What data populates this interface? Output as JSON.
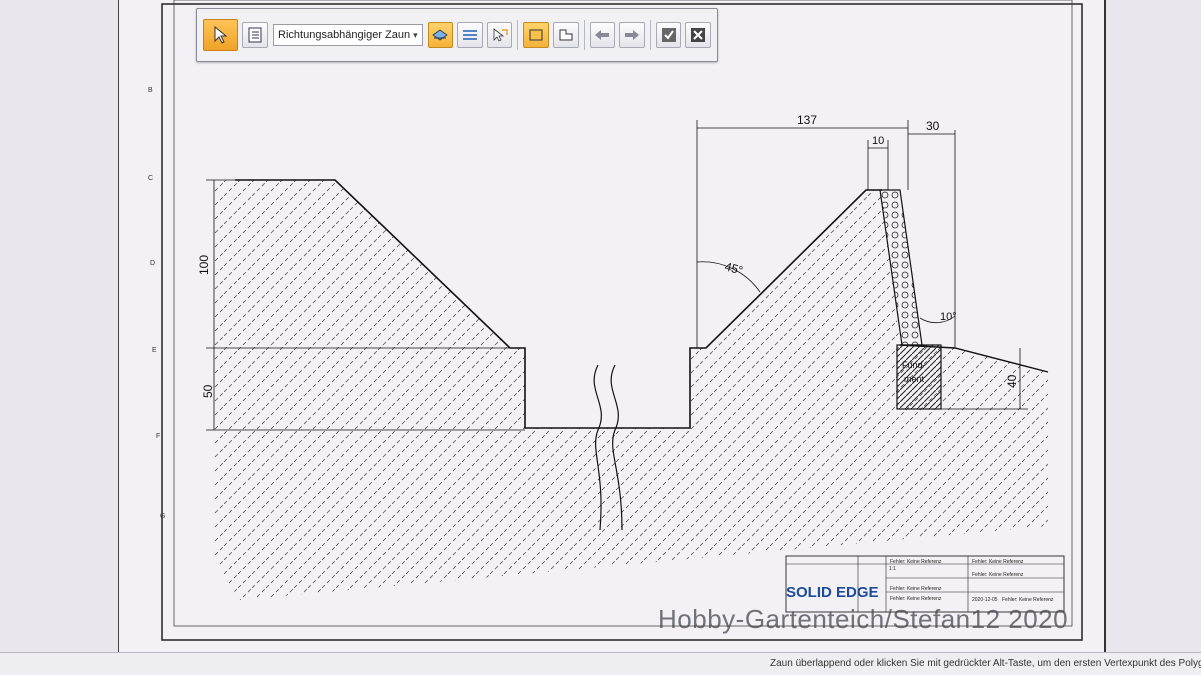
{
  "toolbar": {
    "fence_type": "Richtungsabhängiger Zaun",
    "icons": [
      "select-arrow-icon",
      "properties-icon",
      "fence-style-icon",
      "fill-icon",
      "vertex-select-icon",
      "rectangle-icon",
      "region-icon",
      "back-arrow-icon",
      "forward-arrow-icon",
      "accept-check-icon",
      "cancel-x-icon"
    ]
  },
  "dimensions": {
    "width_top": "137",
    "wall_top": "10",
    "wall_offset": "30",
    "height_slope": "100",
    "height_step": "50",
    "height_foundation": "40",
    "angle_slope": "45°",
    "angle_wall": "10°"
  },
  "labels": {
    "foundation": [
      "Fund-",
      "ment"
    ]
  },
  "title_block": {
    "logo": "SOLID EDGE",
    "fields": [
      "Fehler: Keine Referenz",
      "Fehler: Keine Referenz",
      "Fehler: Keine Referenz",
      "Fehler: Keine Referenz",
      "Fehler: Keine Referenz",
      "Fehler: Keine Referenz"
    ],
    "date": "2020-12-05",
    "scale": "1:1"
  },
  "status_bar": {
    "text": "Zaun überlappend oder klicken Sie mit gedrückter Alt-Taste, um den ersten Vertexpunkt des Polygonzauns zu"
  },
  "watermark": "Hobby-Gartenteich/Stefan12 2020",
  "colors": {
    "accent": "#f4a52b",
    "line": "#1a1a1a",
    "paper": "#f3f1f6"
  }
}
